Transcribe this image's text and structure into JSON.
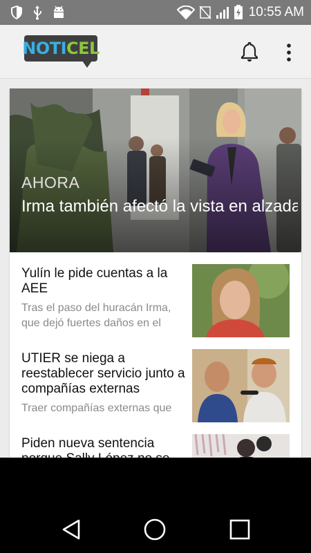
{
  "status_bar": {
    "time": "10:55 AM",
    "icons": [
      "shield-icon",
      "usb-icon",
      "android-debug-icon",
      "wifi-icon",
      "no-sim-icon",
      "signal-icon",
      "battery-charging-icon"
    ]
  },
  "app_bar": {
    "logo_part1": "NOTI",
    "logo_part2": "CEL",
    "colors": {
      "logo_blue": "#3aaee0",
      "logo_green": "#8cc63f",
      "logo_bg": "#3f3f3f"
    },
    "actions": [
      "bell-icon",
      "overflow-menu-icon"
    ]
  },
  "hero": {
    "kicker": "AHORA",
    "title": "Irma también afectó la vista en alzada contra estudiantes de la"
  },
  "articles": [
    {
      "title": "Yulín le pide cuentas a la AEE",
      "description": "Tras el paso del huracán Irma, que dejó fuertes daños en el"
    },
    {
      "title": "UTIER se niega a reestablecer servicio junto a compañías externas",
      "description": "Traer compañías externas que"
    },
    {
      "title": "Piden nueva sentencia porque Sally López no se",
      "description": ""
    }
  ],
  "nav_bar": {
    "buttons": [
      "back-icon",
      "home-icon",
      "recents-icon"
    ]
  }
}
